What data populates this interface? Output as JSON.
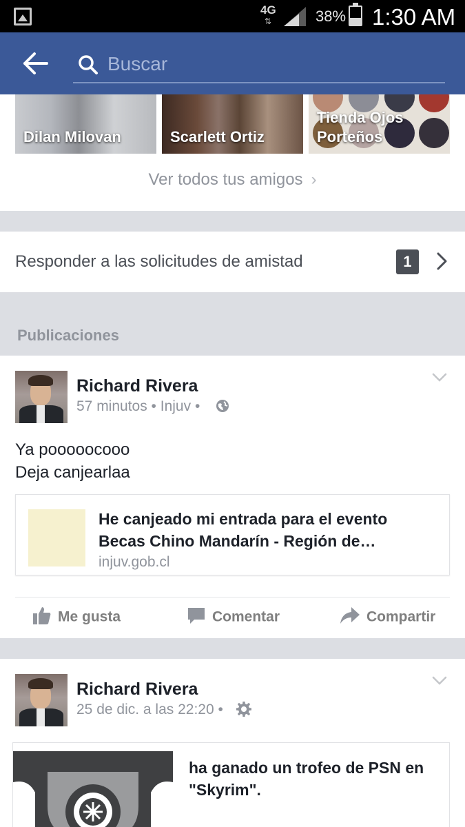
{
  "status_bar": {
    "network": "4G",
    "battery_pct": "38%",
    "time": "1:30 AM"
  },
  "header": {
    "search_placeholder": "Buscar",
    "color": "#3b5998"
  },
  "friends": {
    "tiles": [
      {
        "name": "Dilan Milovan"
      },
      {
        "name": "Scarlett Ortiz"
      },
      {
        "name": "Tienda Ojos\nPorteños"
      }
    ],
    "see_all": "Ver todos tus amigos"
  },
  "requests": {
    "label": "Responder a las solicitudes de amistad",
    "count": "1"
  },
  "section_title": "Publicaciones",
  "posts": [
    {
      "author": "Richard Rivera",
      "meta": "57 minutos • Injuv •",
      "privacy_icon": "globe-icon",
      "text_line1": "Ya poooooc​ooo",
      "text_line2": "Deja canjearlaa",
      "link": {
        "title": "He canjeado mi entrada para el evento Becas Chino Mandarín - Región de…",
        "domain": "injuv.gob.cl"
      },
      "actions": {
        "like": "Me gusta",
        "comment": "Comentar",
        "share": "Compartir"
      }
    },
    {
      "author": "Richard Rivera",
      "meta": "25 de dic. a las 22:20 •",
      "privacy_icon": "gear-icon",
      "attachment_text": "ha ganado un trofeo de PSN en \"Skyrim\"."
    }
  ]
}
